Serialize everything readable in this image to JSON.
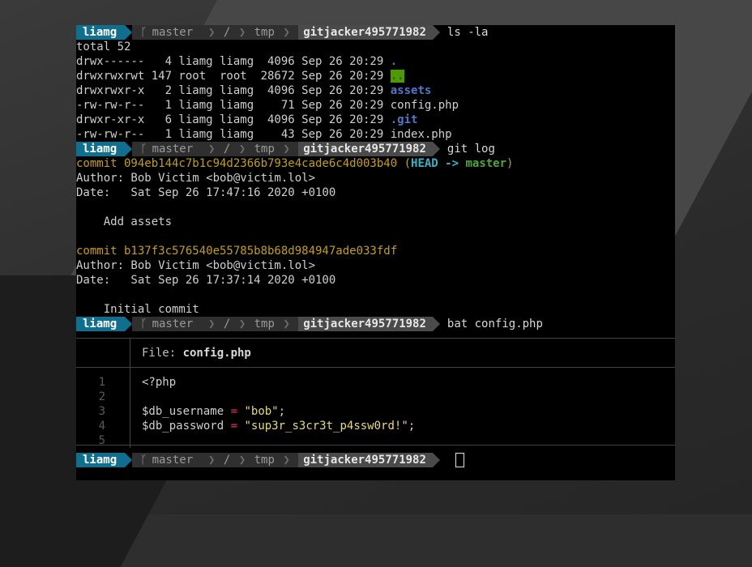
{
  "prompt": {
    "user": "liamg",
    "branch": "master",
    "root": "/",
    "dir": "tmp",
    "repo": "gitjacker495771982"
  },
  "commands": {
    "ls": "ls -la",
    "gitlog": "git log",
    "bat": "bat config.php",
    "current": ""
  },
  "ls_output": {
    "total": "total 52",
    "rows": [
      {
        "meta": "drwx------   4 liamg liamg  4096 Sep 26 20:29 ",
        "name": "."
      },
      {
        "meta": "drwxrwxrwt 147 root  root  28672 Sep 26 20:29 ",
        "name": ".."
      },
      {
        "meta": "drwxrwxr-x   2 liamg liamg  4096 Sep 26 20:29 ",
        "name": "assets"
      },
      {
        "meta": "-rw-rw-r--   1 liamg liamg    71 Sep 26 20:29 ",
        "name": "config.php"
      },
      {
        "meta": "drwxr-xr-x   6 liamg liamg  4096 Sep 26 20:29 ",
        "name": ".git"
      },
      {
        "meta": "-rw-rw-r--   1 liamg liamg    43 Sep 26 20:29 ",
        "name": "index.php"
      }
    ]
  },
  "git_log": {
    "commit1": {
      "hash_line": "commit 094eb144c7b1c94d2366b793e4cade6c4d003b40",
      "head": "HEAD ->",
      "branch": "master",
      "author": "Author: Bob Victim <bob@victim.lol>",
      "date": "Date:   Sat Sep 26 17:47:16 2020 +0100",
      "message": "    Add assets"
    },
    "commit2": {
      "hash_line": "commit b137f3c576540e55785b8b68d984947ade033fdf",
      "author": "Author: Bob Victim <bob@victim.lol>",
      "date": "Date:   Sat Sep 26 17:37:14 2020 +0100",
      "message": "    Initial commit"
    }
  },
  "bat": {
    "file_label": "File: ",
    "file_name": "config.php",
    "lines": [
      {
        "num": "1",
        "code": "<?php"
      },
      {
        "num": "2",
        "code": ""
      },
      {
        "num": "3",
        "var": "$db_username",
        "op": "=",
        "str": "\"bob\"",
        "end": ";"
      },
      {
        "num": "4",
        "var": "$db_password",
        "op": "=",
        "str": "\"sup3r_s3cr3t_p4ssw0rd!\"",
        "end": ";"
      },
      {
        "num": "5",
        "code": ""
      }
    ]
  }
}
